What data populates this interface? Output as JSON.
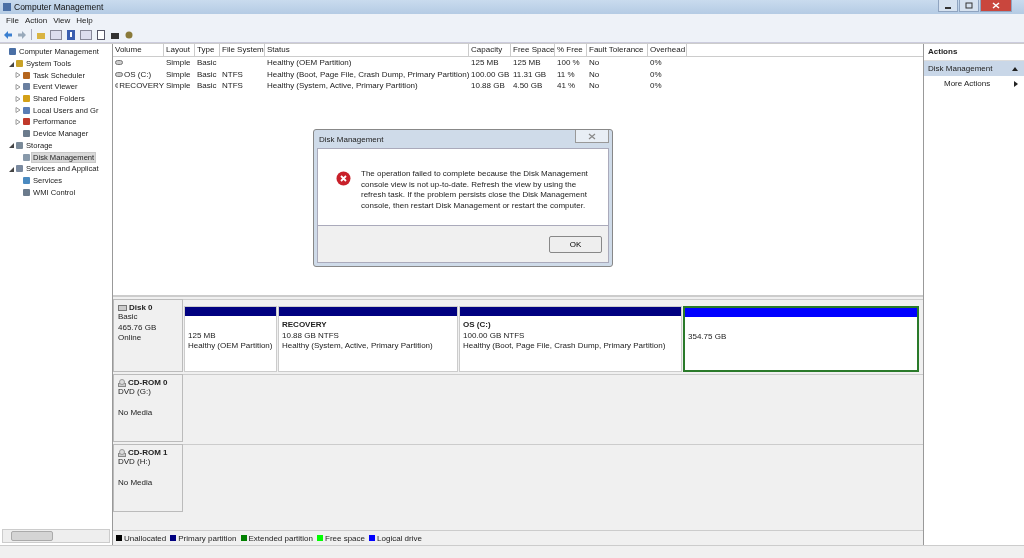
{
  "window": {
    "title": "Computer Management"
  },
  "menu": [
    "File",
    "Action",
    "View",
    "Help"
  ],
  "tree": [
    {
      "label": "Computer Management",
      "selected": false,
      "children": [
        {
          "label": "System Tools",
          "selected": false,
          "expanded": true,
          "children": [
            {
              "label": "Task Scheduler",
              "selected": false,
              "expanded": false
            },
            {
              "label": "Event Viewer",
              "selected": false,
              "expanded": false
            },
            {
              "label": "Shared Folders",
              "selected": false,
              "expanded": false
            },
            {
              "label": "Local Users and Gr",
              "selected": false,
              "expanded": false
            },
            {
              "label": "Performance",
              "selected": false,
              "expanded": false
            },
            {
              "label": "Device Manager",
              "selected": false
            }
          ]
        },
        {
          "label": "Storage",
          "selected": false,
          "expanded": true,
          "children": [
            {
              "label": "Disk Management",
              "selected": true
            }
          ]
        },
        {
          "label": "Services and Applicat",
          "selected": false,
          "expanded": true,
          "children": [
            {
              "label": "Services",
              "selected": false
            },
            {
              "label": "WMI Control",
              "selected": false
            }
          ]
        }
      ]
    }
  ],
  "volumes": {
    "columns": [
      "Volume",
      "Layout",
      "Type",
      "File System",
      "Status",
      "Capacity",
      "Free Space",
      "% Free",
      "Fault Tolerance",
      "Overhead"
    ],
    "rows": [
      {
        "layout": "Simple",
        "type": "Basic",
        "status": "Healthy (OEM Partition)",
        "capacity": "125 MB",
        "free_space": "125 MB",
        "pct_free": "100 %",
        "fault_tolerance": "No",
        "overhead": "0%"
      },
      {
        "volume": "OS (C:)",
        "layout": "Simple",
        "type": "Basic",
        "file_system": "NTFS",
        "status": "Healthy (Boot, Page File, Crash Dump, Primary Partition)",
        "capacity": "100.00 GB",
        "free_space": "11.31 GB",
        "pct_free": "11 %",
        "fault_tolerance": "No",
        "overhead": "0%"
      },
      {
        "volume": "RECOVERY",
        "layout": "Simple",
        "type": "Basic",
        "file_system": "NTFS",
        "status": "Healthy (System, Active, Primary Partition)",
        "capacity": "10.88 GB",
        "free_space": "4.50 GB",
        "pct_free": "41 %",
        "fault_tolerance": "No",
        "overhead": "0%"
      }
    ]
  },
  "disks": [
    {
      "name": "Disk 0",
      "kind": "disk",
      "lines": [
        "Basic",
        "465.76 GB",
        "Online"
      ],
      "partitions": [
        {
          "size": "125 MB",
          "status": "Healthy (OEM Partition)",
          "color": "#000080",
          "extended": false
        },
        {
          "name": "RECOVERY",
          "size": "10.88 GB NTFS",
          "status": "Healthy (System, Active, Primary Partition)",
          "color": "#000080",
          "extended": false
        },
        {
          "name": "OS  (C:)",
          "size": "100.00 GB NTFS",
          "status": "Healthy (Boot, Page File, Crash Dump, Primary Partition)",
          "color": "#000080",
          "extended": false
        },
        {
          "size": "354.75 GB",
          "color": "#0000ff",
          "extended": true
        }
      ]
    },
    {
      "name": "CD-ROM 0",
      "kind": "cdrom",
      "lines": [
        "DVD (G:)",
        "No Media"
      ]
    },
    {
      "name": "CD-ROM 1",
      "kind": "cdrom",
      "lines": [
        "DVD (H:)",
        "No Media"
      ]
    }
  ],
  "legend": [
    {
      "label": "Unallocated",
      "color": "#000000"
    },
    {
      "label": "Primary partition",
      "color": "#000080"
    },
    {
      "label": "Extended partition",
      "color": "#008000"
    },
    {
      "label": "Free space",
      "color": "#00ff00"
    },
    {
      "label": "Logical drive",
      "color": "#0000ff"
    }
  ],
  "actions": {
    "title": "Actions",
    "section": "Disk Management",
    "items": [
      {
        "label": "More Actions"
      }
    ]
  },
  "dialog": {
    "title": "Disk Management",
    "message": "The operation failed to complete because the Disk Management console view is not up-to-date.  Refresh the view by using the refresh task. If the problem persists close the Disk Management console, then restart Disk Management or restart the computer.",
    "button": "OK"
  }
}
